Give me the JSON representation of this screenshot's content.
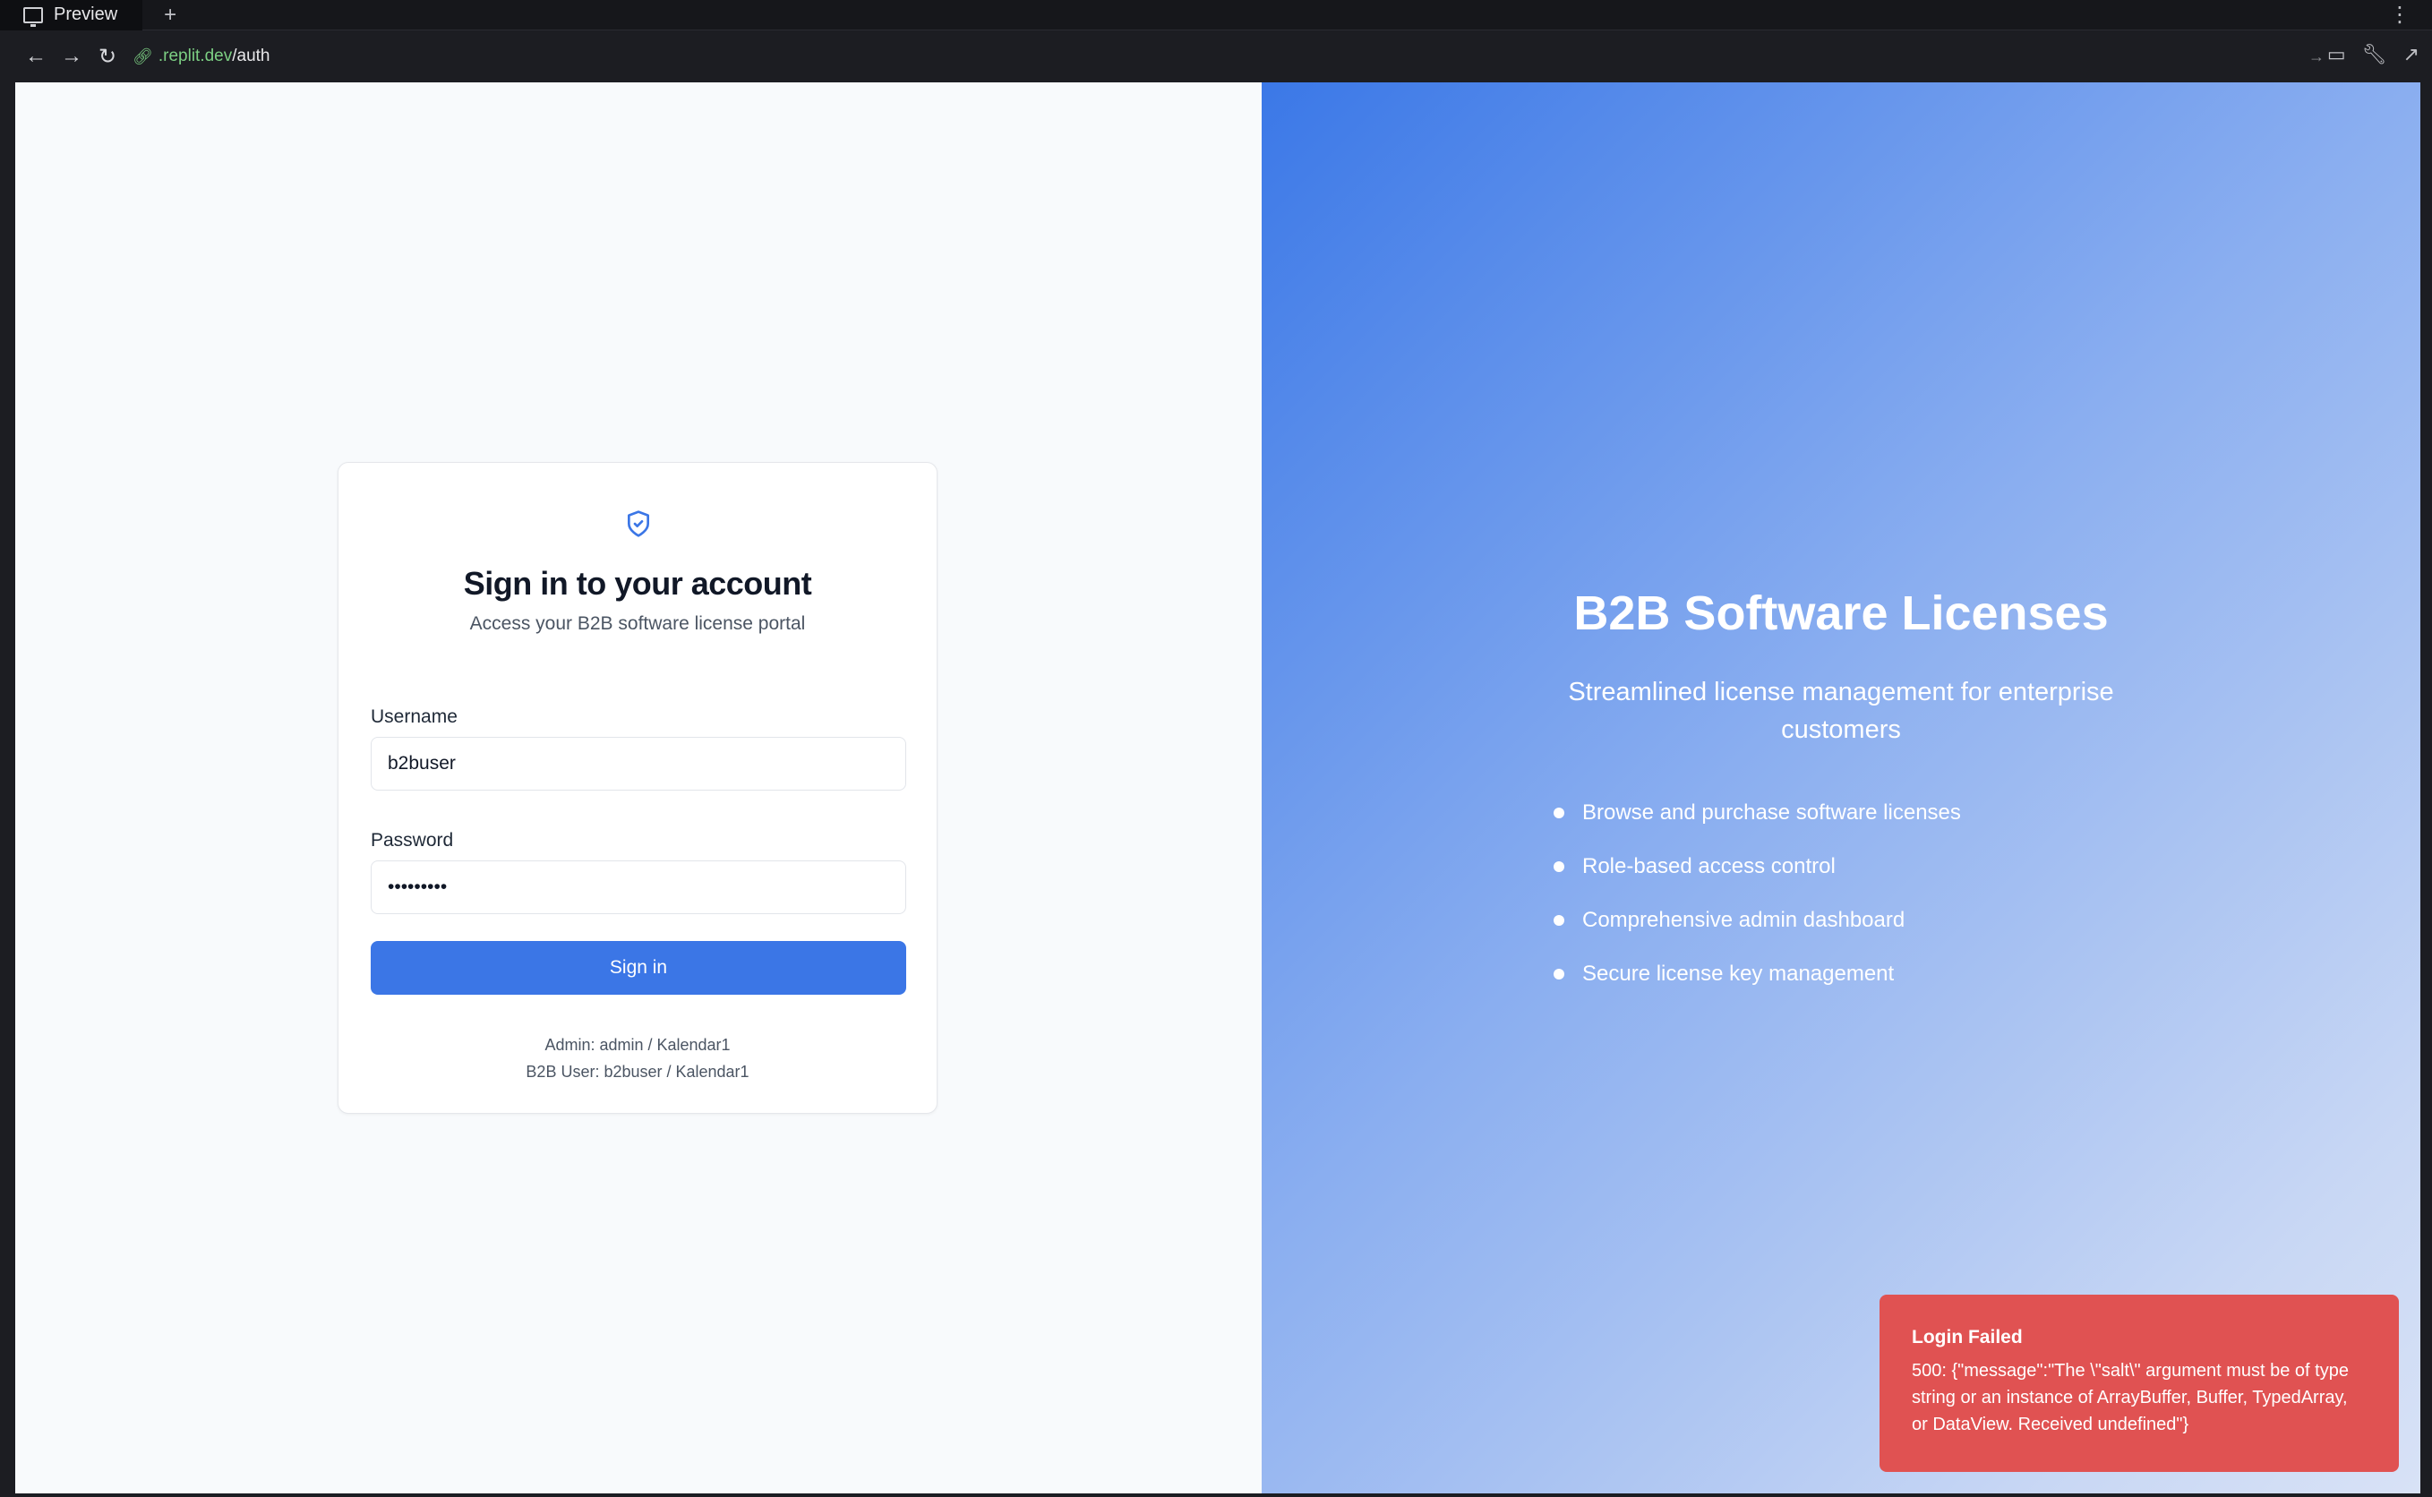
{
  "browser": {
    "tab_label": "Preview",
    "new_tab": "+",
    "menu": "⋮",
    "url_domain": ".replit.dev",
    "url_path": "/auth"
  },
  "auth_card": {
    "title": "Sign in to your account",
    "subtitle": "Access your B2B software license portal",
    "username_label": "Username",
    "username_value": "b2buser",
    "password_label": "Password",
    "password_value": "Kalendar1",
    "submit_label": "Sign in",
    "hint_admin": "Admin: admin / Kalendar1",
    "hint_user": "B2B User: b2buser / Kalendar1"
  },
  "hero": {
    "title": "B2B Software Licenses",
    "tagline": "Streamlined license management for enterprise customers",
    "features": [
      "Browse and purchase software licenses",
      "Role-based access control",
      "Comprehensive admin dashboard",
      "Secure license key management"
    ]
  },
  "toast": {
    "title": "Login Failed",
    "message": "500: {\"message\":\"The \\\"salt\\\" argument must be of type string or an instance of ArrayBuffer, Buffer, TypedArray, or DataView. Received undefined\"}"
  },
  "colors": {
    "primary": "#3b76e6",
    "error": "#e05252",
    "url_domain": "#7ccf83"
  }
}
